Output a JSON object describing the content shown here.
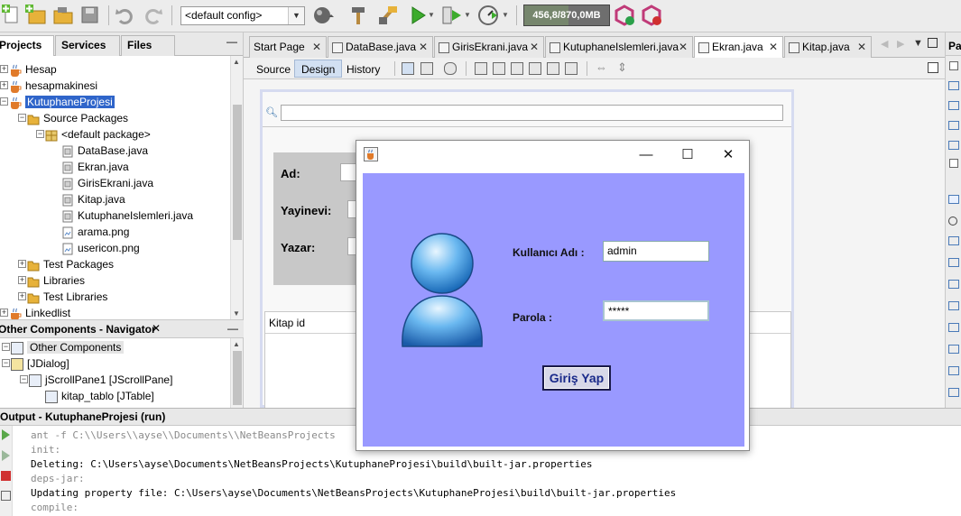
{
  "toolbar": {
    "config_value": "<default config>",
    "memory_text": "456,8/870,0MB",
    "memory_fraction": 0.525
  },
  "projects_panel": {
    "tabs": [
      "Projects",
      "Services",
      "Files"
    ],
    "minimize": "—",
    "tree": [
      {
        "label": "Hesap",
        "icon": "project-icon"
      },
      {
        "label": "hesapmakinesi",
        "icon": "project-icon"
      },
      {
        "label": "KutuphaneProjesi",
        "icon": "project-icon",
        "selected": true
      },
      {
        "label": "Source Packages",
        "icon": "folder-icon"
      },
      {
        "label": "<default package>",
        "icon": "package-icon"
      },
      {
        "label": "DataBase.java",
        "icon": "java-file-icon"
      },
      {
        "label": "Ekran.java",
        "icon": "java-file-icon"
      },
      {
        "label": "GirisEkrani.java",
        "icon": "java-file-icon"
      },
      {
        "label": "Kitap.java",
        "icon": "java-file-icon"
      },
      {
        "label": "KutuphaneIslemleri.java",
        "icon": "java-file-icon"
      },
      {
        "label": "arama.png",
        "icon": "image-file-icon"
      },
      {
        "label": "usericon.png",
        "icon": "image-file-icon"
      },
      {
        "label": "Test Packages",
        "icon": "folder-icon"
      },
      {
        "label": "Libraries",
        "icon": "folder-icon"
      },
      {
        "label": "Test Libraries",
        "icon": "folder-icon"
      },
      {
        "label": "Linkedlist",
        "icon": "project-icon"
      }
    ]
  },
  "navigator": {
    "title": "Other Components - Navigator",
    "close": "✕",
    "minimize": "—",
    "items": [
      "Other Components",
      "[JDialog]",
      "jScrollPane1 [JScrollPane]",
      "kitap_tablo [JTable]"
    ]
  },
  "editor": {
    "tabs": [
      "Start Page",
      "DataBase.java",
      "GirisEkrani.java",
      "KutuphaneIslemleri.java",
      "Ekran.java",
      "Kitap.java"
    ],
    "close": "✕",
    "modes": [
      "Source",
      "Design",
      "History"
    ]
  },
  "form": {
    "labels": [
      "Ad:",
      "Yayinevi:",
      "Yazar:"
    ],
    "table_header": "Kitap id"
  },
  "palette": {
    "label": "Pa"
  },
  "output": {
    "title": "Output - KutuphaneProjesi (run)",
    "lines": [
      "ant -f C:\\\\Users\\\\ayse\\\\Documents\\\\NetBeansProjects",
      "init:",
      "Deleting: C:\\Users\\ayse\\Documents\\NetBeansProjects\\KutuphaneProjesi\\build\\built-jar.properties",
      "deps-jar:",
      "Updating property file: C:\\Users\\ayse\\Documents\\NetBeansProjects\\KutuphaneProjesi\\build\\built-jar.properties",
      "compile:"
    ]
  },
  "dialog": {
    "minimize": "—",
    "maximize": "☐",
    "close": "✕",
    "username_label": "Kullanıcı Adı :",
    "username_value": "admin",
    "password_label": "Parola :",
    "password_value": "*****",
    "login_button": "Giriş Yap",
    "body_color": "#9999ff"
  }
}
